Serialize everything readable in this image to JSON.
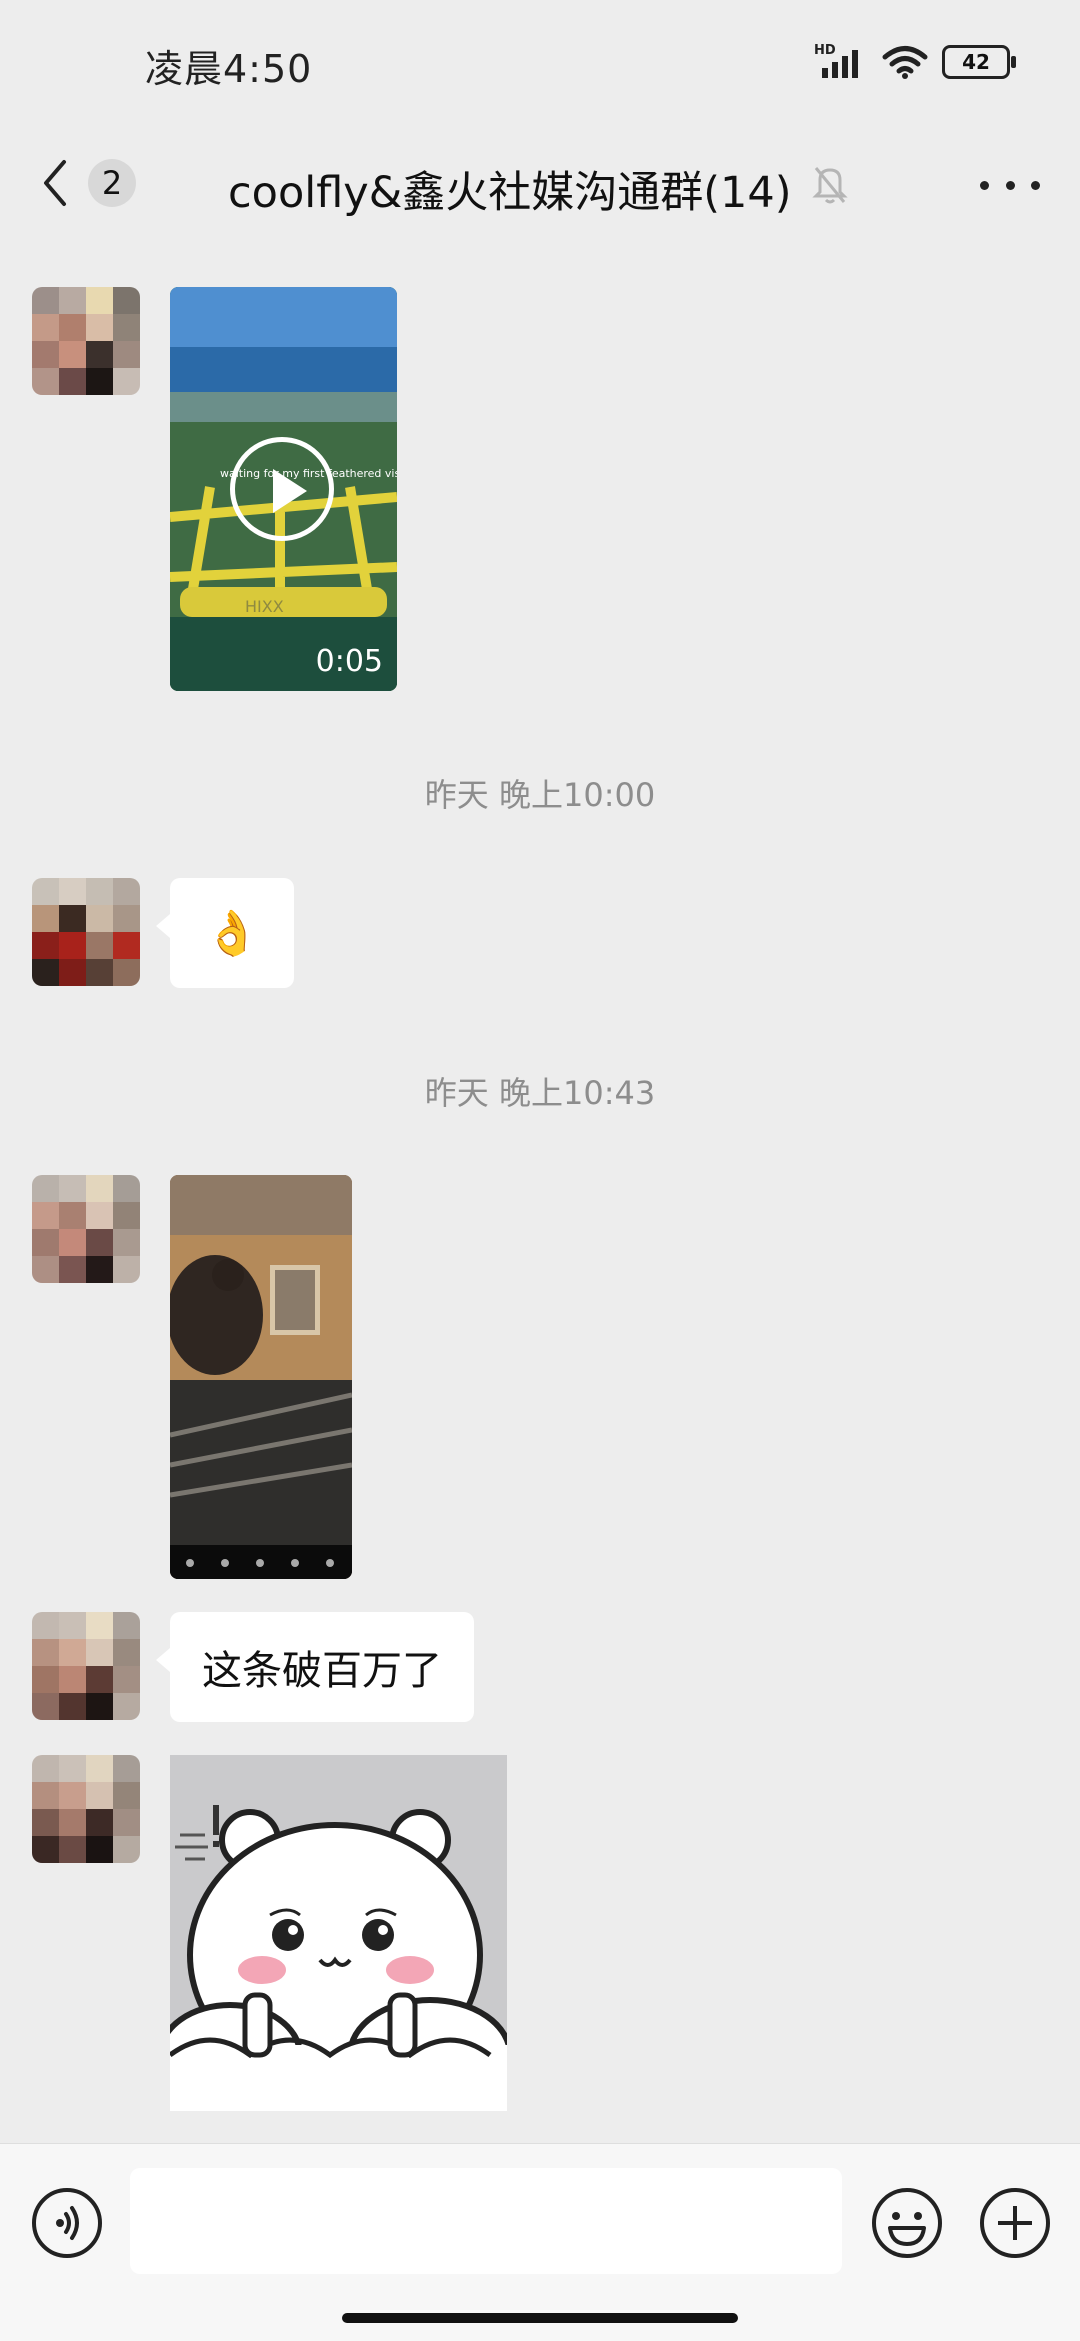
{
  "status_bar": {
    "time": "凌晨4:50",
    "network_label": "HD",
    "battery": "42"
  },
  "nav": {
    "back_count": "2",
    "title": "coolfly&鑫火社媒沟通群(14)"
  },
  "messages": {
    "video_duration": "0:05",
    "video_caption": "waiting for my first feathered visitor",
    "video_watermark": "HIXX",
    "timestamp_1": "昨天 晚上10:00",
    "emoji": "👌",
    "timestamp_2": "昨天 晚上10:43",
    "text": "这条破百万了"
  },
  "input": {
    "placeholder": ""
  }
}
